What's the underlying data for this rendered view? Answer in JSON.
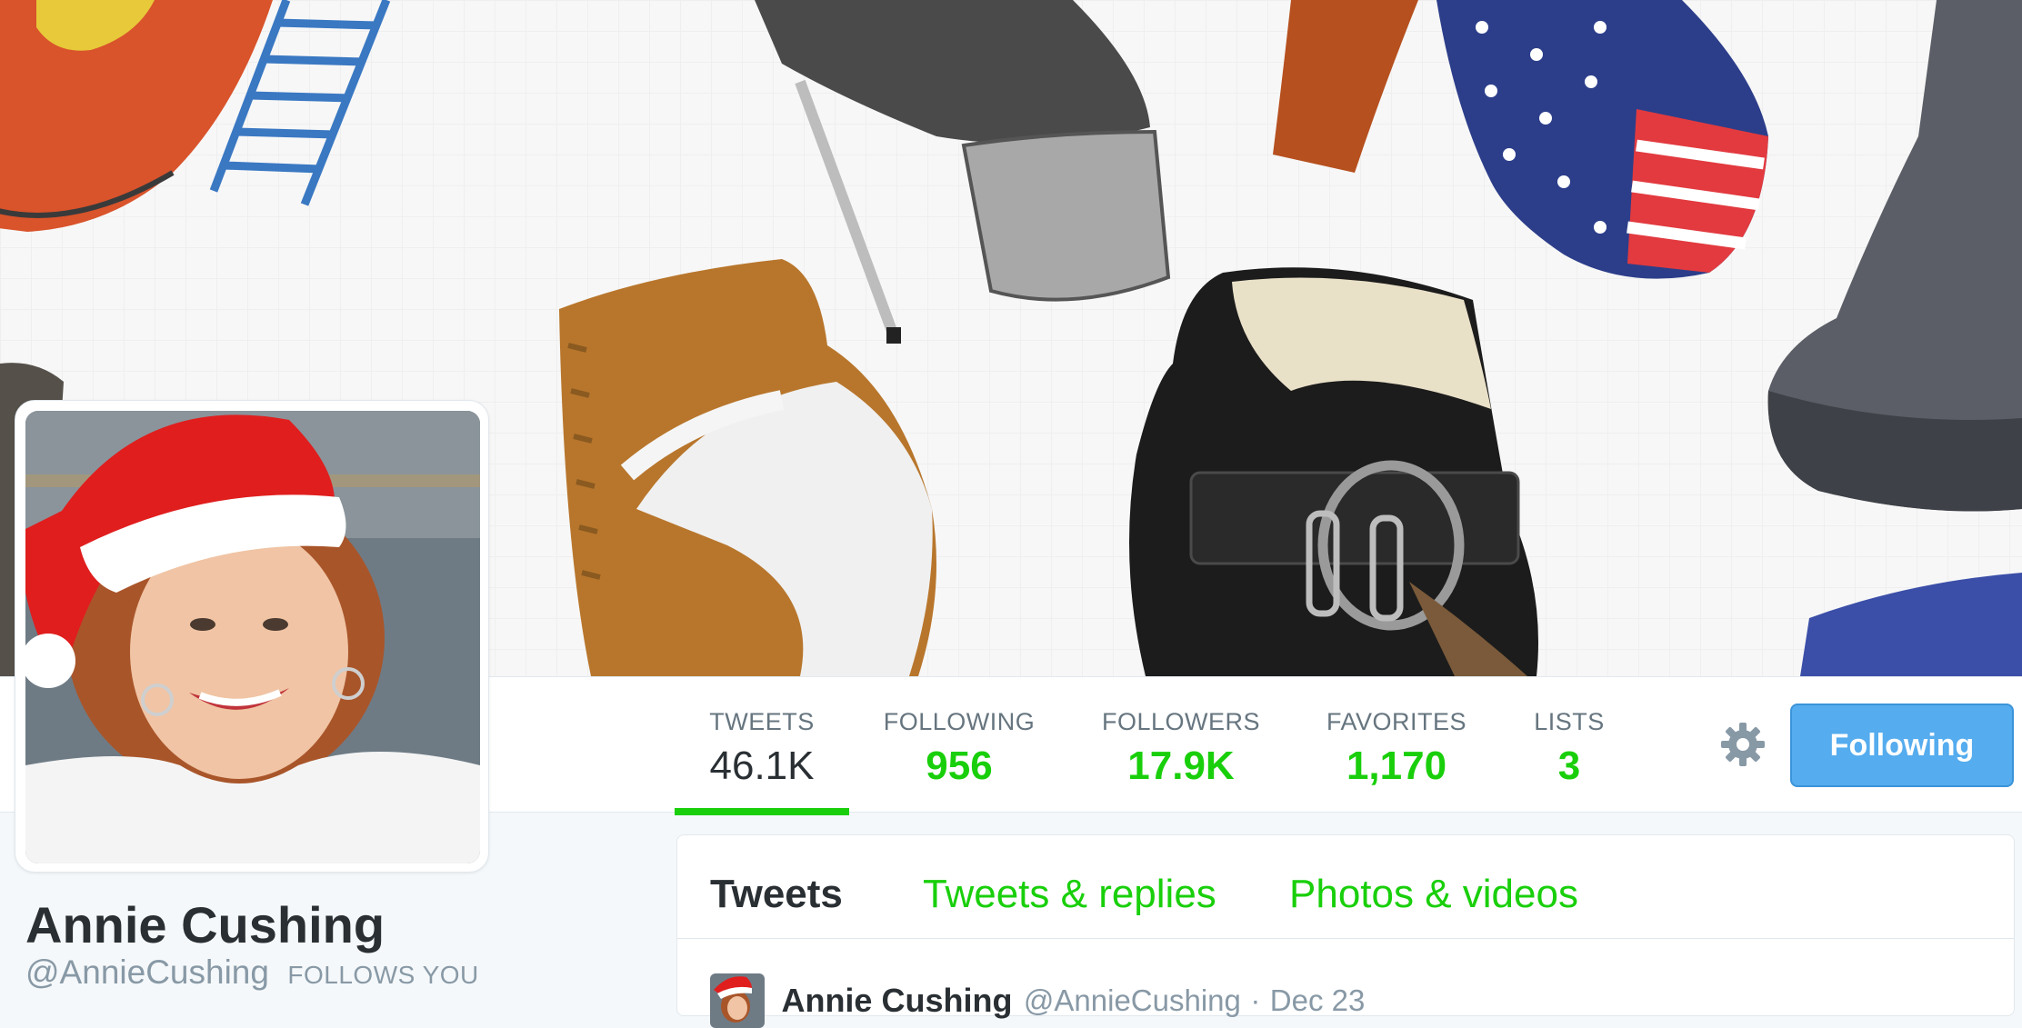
{
  "profile": {
    "name": "Annie Cushing",
    "handle": "@AnnieCushing",
    "follows_you": "FOLLOWS YOU"
  },
  "stats": [
    {
      "label": "TWEETS",
      "value": "46.1K",
      "active": true
    },
    {
      "label": "FOLLOWING",
      "value": "956"
    },
    {
      "label": "FOLLOWERS",
      "value": "17.9K"
    },
    {
      "label": "FAVORITES",
      "value": "1,170"
    },
    {
      "label": "LISTS",
      "value": "3"
    }
  ],
  "actions": {
    "follow_button": "Following",
    "settings_icon": "gear-icon"
  },
  "timeline": {
    "tabs": [
      {
        "label": "Tweets",
        "active": true
      },
      {
        "label": "Tweets & replies"
      },
      {
        "label": "Photos & videos"
      }
    ],
    "first_tweet": {
      "name": "Annie Cushing",
      "handle": "@AnnieCushing",
      "separator": "·",
      "date": "Dec 23"
    }
  },
  "colors": {
    "accent_green": "#19cf0b",
    "button_blue": "#55acee",
    "text_dark": "#292f33",
    "text_muted": "#8899a6"
  }
}
